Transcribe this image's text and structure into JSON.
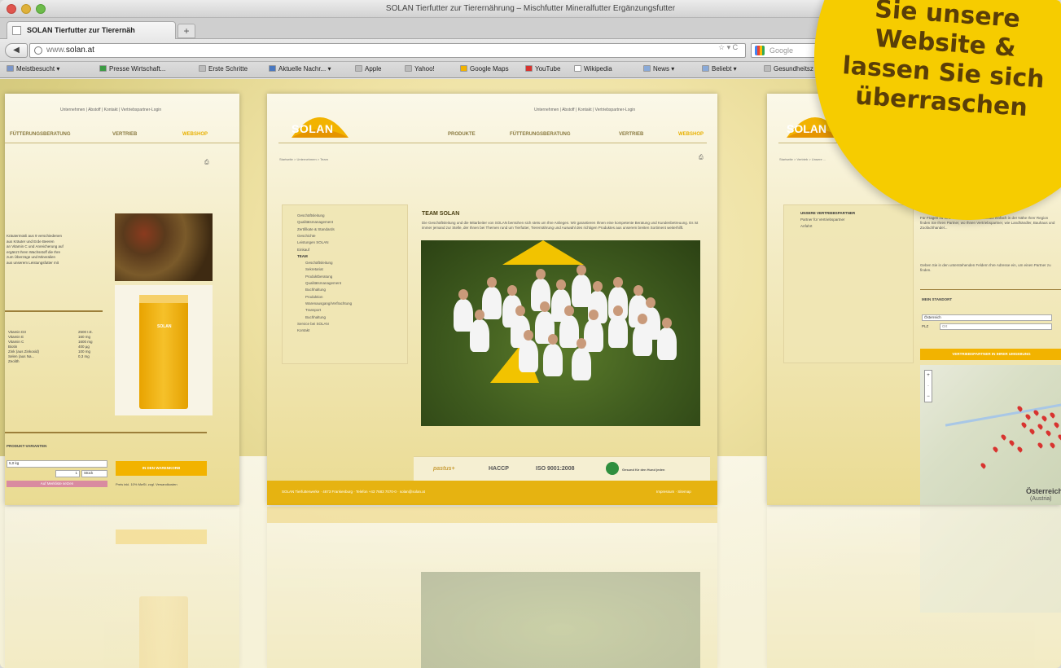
{
  "window": {
    "title": "SOLAN Tierfutter zur Tierernährung – Mischfutter Mineralfutter Ergänzungsfutter"
  },
  "tab": {
    "label": "SOLAN Tierfutter zur Tierernäh",
    "new_tab": "+"
  },
  "navbar": {
    "back": "◀",
    "url_scheme": "www.",
    "url_host": "solan.at",
    "url_tools": "☆ ▾ C",
    "search_placeholder": "Google"
  },
  "bookmarks": [
    {
      "label": "Meistbesucht ▾",
      "color": "#7a95c8"
    },
    {
      "label": "Presse Wirtschaft...",
      "color": "#3c9b44"
    },
    {
      "label": "Erste Schritte",
      "color": "#bbbbbb"
    },
    {
      "label": "Aktuelle Nachr... ▾",
      "color": "#4a78c0"
    },
    {
      "label": "Apple",
      "color": "#bbbbbb"
    },
    {
      "label": "Yahoo!",
      "color": "#bbbbbb"
    },
    {
      "label": "Google Maps",
      "color": "#f2b300"
    },
    {
      "label": "YouTube",
      "color": "#d8332f"
    },
    {
      "label": "Wikipedia",
      "color": "#ffffff"
    },
    {
      "label": "News ▾",
      "color": "#8aaad8"
    },
    {
      "label": "Beliebt ▾",
      "color": "#8aaad8"
    },
    {
      "label": "Gesundheitsz",
      "color": "#bbbbbb"
    }
  ],
  "site": {
    "logo": "SOLAN",
    "top_links": "Unternehmen  |  Abstoff  |  Kontakt  |  Vertriebspartner-Login",
    "nav": [
      "PRODUKTE",
      "FÜTTERUNGSBERATUNG",
      "VERTRIEB",
      "WEBSHOP"
    ],
    "breadcrumb": "Startseite > Unternehmen > Team",
    "sidebar": [
      {
        "label": "Geschäftsleitung",
        "bold": false
      },
      {
        "label": "Qualitätsmanagement",
        "bold": false
      },
      {
        "label": "Zertifikate & Standards",
        "bold": false
      },
      {
        "label": "Geschichte",
        "bold": false
      },
      {
        "label": "Leistungen SOLAN",
        "bold": false
      },
      {
        "label": "Einkauf",
        "bold": false
      },
      {
        "label": "TEAM",
        "bold": true
      },
      {
        "label": "Geschäftsleitung",
        "bold": false
      },
      {
        "label": "Sekretariat",
        "bold": false
      },
      {
        "label": "Produktberatung",
        "bold": false
      },
      {
        "label": "Qualitätsmanagement",
        "bold": false
      },
      {
        "label": "Buchhaltung",
        "bold": false
      },
      {
        "label": "Produktion",
        "bold": false
      },
      {
        "label": "Warenausgang/Verfrachtung",
        "bold": false
      },
      {
        "label": "Transport",
        "bold": false
      },
      {
        "label": "Buchhaltung",
        "bold": false
      },
      {
        "label": "Service bei SOLAN",
        "bold": false
      },
      {
        "label": "Kontakt",
        "bold": false
      }
    ],
    "team_title": "TEAM SOLAN",
    "team_text": "Die Geschäftsleitung und die Mitarbeiter von SOLAN bemühen sich stets um Ihre Anliegen. Wir garantieren Ihnen eine kompetente Beratung und Kundenbetreuung. Es ist immer jemand zur Stelle, der Ihnen bei Themen rund um Tierfutter, Tierernährung und Auswahl des richtigen Produktes aus unserem breiten Sortiment weiterhilft.",
    "footer_logos": [
      "pastus+",
      "HACCP",
      "ISO 9001:2008",
      "Gesund für den Hund jeden"
    ],
    "footer_left": "SOLAN Tierfutterwerke  ·  4873 Frankenburg  ·  Telefon +43 7683 7070-0  ·  solan@solan.at",
    "footer_right": "Impressum  ·  Sitemap"
  },
  "left_card": {
    "top_links": "Unternehmen  |  Abstoff  |  Kontakt  |  Vertriebspartner-Login",
    "nav": [
      "FÜTTERUNGSBERATUNG",
      "VERTRIEB",
      "WEBSHOP"
    ],
    "text_lines": [
      "Kräutermüsli aus 9 verschiedenen",
      "aus Kräuter und Erde Beeren",
      "an Vitamin C und Anreicherung auf",
      "ergänzt Ihren Wachsstoff die Ihre",
      "zum Überzüge und Mineralien",
      "aus unserem Leistungsfutter mit"
    ],
    "nutrients": [
      {
        "name": "Vitamin D3",
        "value": "2500 I.E."
      },
      {
        "name": "Vitamin E",
        "value": "160 mg"
      },
      {
        "name": "Vitamin C",
        "value": "1600 mg"
      },
      {
        "name": "Biotin",
        "value": "400 µg"
      },
      {
        "name": "Zink (aus Zinkoxid)",
        "value": "100 mg"
      },
      {
        "name": "Selen (aus Na...",
        "value": "0,3 mg"
      },
      {
        "name": "Zeolith",
        "value": ""
      }
    ],
    "variants_title": "PRODUKT-VARIANTEN",
    "variant_value": "5,0 kg",
    "qty": "1",
    "stock": "Stück",
    "order_button": "IN DEN WARENKORB",
    "watchlist_button": "Auf Merkliste setzen",
    "price_note": "Preis inkl. 10% MwSt. zzgl. Versandkosten",
    "bag_label": "SOLAN"
  },
  "right_card": {
    "logo": "SOLAN",
    "breadcrumb": "Startseite > Vertrieb > Unsere ...",
    "sidebar_title": "UNSERE VERTRIEBSPARTNER",
    "sidebar_items": [
      "Partner für Vertriebspartner",
      "Anfahrt"
    ],
    "text": "Für Fragen zu Ihrer Fütterung und Hofeinkauf einfach in der Nähe Ihrer Region finden Sie Ihren Partner, wo Ihnen Vertriebspartner, wie Landhändler, Bauhaus und Zoofachhandel...",
    "text2": "Geben Sie in den unterstehenden Feldern Ihre Adresse ein, um einen Partner zu finden.",
    "section_title": "MEIN STANDORT",
    "country": "Österreich",
    "plz_label": "PLZ",
    "ort_placeholder": "Ort",
    "partner_banner": "VERTRIEBSPARTNER IN IHRER UMGEBUNG",
    "map_label": "Österreich",
    "map_sublabel": "(Austria)"
  },
  "sticker": {
    "text": "Sie unsere\nWebsite &\nlassen Sie sich\nüberraschen"
  }
}
